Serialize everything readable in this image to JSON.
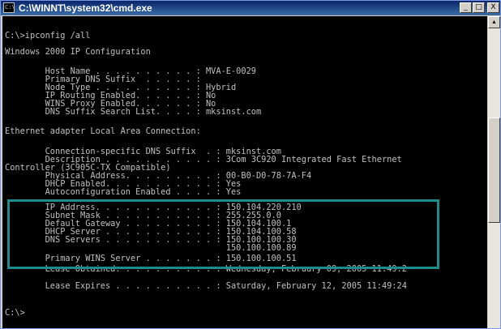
{
  "window": {
    "title": "C:\\WINNT\\system32\\cmd.exe",
    "title_icon": "C:\\",
    "buttons": {
      "minimize": "_",
      "maximize": "□",
      "close": "X"
    }
  },
  "console": {
    "lines": [
      "C:\\>ipconfig /all",
      "Windows 2000 IP Configuration",
      "        Host Name . . . . . . . . . . : MVA-E-0029",
      "        Primary DNS Suffix  . . . . . :",
      "        Node Type . . . . . . . . . . : Hybrid",
      "        IP Routing Enabled. . . . . . : No",
      "        WINS Proxy Enabled. . . . . . : No",
      "        DNS Suffix Search List. . . . : mksinst.com",
      "Ethernet adapter Local Area Connection:",
      "        Connection-specific DNS Suffix  . : mksinst.com",
      "        Description . . . . . . . . . . . : 3Com 3C920 Integrated Fast Ethernet",
      "Controller (3C905C-TX Compatible)",
      "        Physical Address. . . . . . . . . : 00-B0-D0-78-7A-F4",
      "        DHCP Enabled. . . . . . . . . . . : Yes",
      "        Autoconfiguration Enabled . . . . : Yes",
      "        IP Address. . . . . . . . . . . . : 150.104.220.210",
      "        Subnet Mask . . . . . . . . . . . : 255.255.0.0",
      "        Default Gateway . . . . . . . . . : 150.104.100.1",
      "        DHCP Server . . . . . . . . . . . : 150.104.100.58",
      "        DNS Servers . . . . . . . . . . . : 150.100.100.30",
      "                                            150.100.100.89",
      "        Primary WINS Server . . . . . . . : 150.100.100.51",
      "        Lease Obtained. . . . . . . . . . : Wednesday, February 09, 2005 11:49:2",
      "        Lease Expires . . . . . . . . . . : Saturday, February 12, 2005 11:49:24",
      "C:\\>"
    ]
  },
  "highlight": {
    "color": "#1f8c8c"
  },
  "scrollbar": {
    "up_arrow": "▲"
  }
}
